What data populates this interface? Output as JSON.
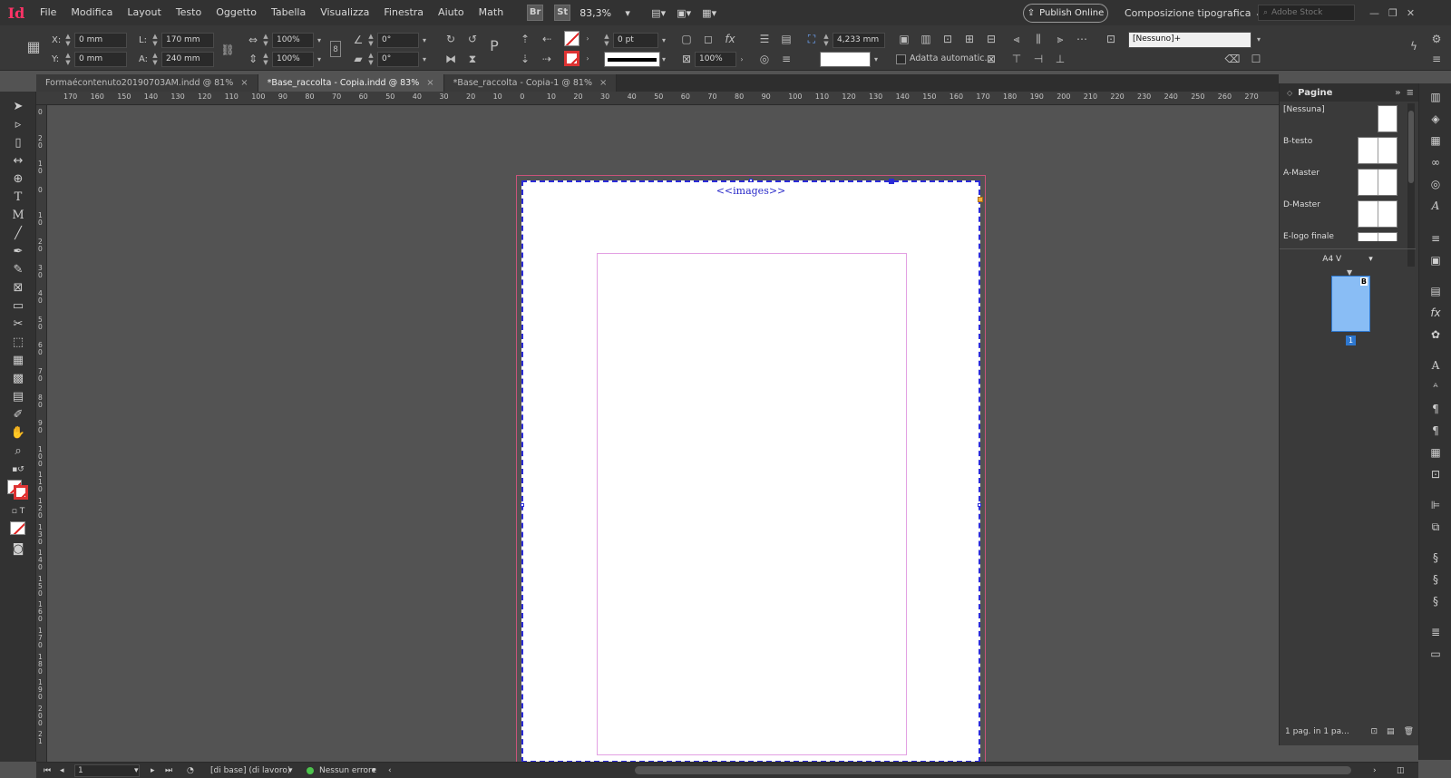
{
  "app": {
    "logo": "Id"
  },
  "menu": [
    "File",
    "Modifica",
    "Layout",
    "Testo",
    "Oggetto",
    "Tabella",
    "Visualizza",
    "Finestra",
    "Aiuto",
    "Math"
  ],
  "menubar": {
    "bridge_badge": "Br",
    "stock_badge": "St",
    "zoom": "83,3%",
    "publish_label": "Publish Online",
    "workspace": "Composizione tipografica",
    "stock_placeholder": "Adobe Stock"
  },
  "control": {
    "x_label": "X:",
    "x_value": "0 mm",
    "y_label": "Y:",
    "y_value": "0 mm",
    "w_label": "L:",
    "w_value": "170 mm",
    "h_label": "A:",
    "h_value": "240 mm",
    "scale_x": "100%",
    "scale_y": "100%",
    "rotation": "0°",
    "shear": "0°",
    "stroke_weight": "0 pt",
    "opacity": "100%",
    "offset_value": "4,233 mm",
    "autofit_label": "Adatta automatic...",
    "style_value": "[Nessuno]+"
  },
  "tabs": [
    {
      "label": "Formaécontenuto20190703AM.indd @ 81%",
      "active": false
    },
    {
      "label": "*Base_raccolta - Copia.indd @ 83%",
      "active": true
    },
    {
      "label": "*Base_raccolta - Copia-1 @ 81%",
      "active": false
    }
  ],
  "ruler_h": [
    "170",
    "160",
    "150",
    "140",
    "130",
    "120",
    "110",
    "100",
    "90",
    "80",
    "70",
    "60",
    "50",
    "40",
    "30",
    "20",
    "10",
    "0",
    "10",
    "20",
    "30",
    "40",
    "50",
    "60",
    "70",
    "80",
    "90",
    "100",
    "110",
    "120",
    "130",
    "140",
    "150",
    "160",
    "170",
    "180",
    "190",
    "200",
    "210",
    "220",
    "230",
    "240",
    "250",
    "260",
    "270"
  ],
  "ruler_v": [
    "0",
    "2\n0",
    "1\n0",
    "0",
    "1\n0",
    "2\n0",
    "3\n0",
    "4\n0",
    "5\n0",
    "6\n0",
    "7\n0",
    "8\n0",
    "9\n0",
    "1\n0\n0",
    "1\n1\n0",
    "1\n2\n0",
    "1\n3\n0",
    "1\n4\n0",
    "1\n5\n0",
    "1\n6\n0",
    "1\n7\n0",
    "1\n8\n0",
    "1\n9\n0",
    "2\n0\n0",
    "2\n1"
  ],
  "document": {
    "placeholder": "<<images>>"
  },
  "pages_panel": {
    "title": "Pagine",
    "masters": [
      {
        "name": "[Nessuna]",
        "double": false
      },
      {
        "name": "B-testo",
        "double": true
      },
      {
        "name": "A-Master",
        "double": true
      },
      {
        "name": "D-Master",
        "double": true
      },
      {
        "name": "E-logo finale",
        "double": true
      }
    ],
    "page_size": "A4 V",
    "page_master_letter": "B",
    "page_number": "1",
    "footer": "1 pag. in 1 pa..."
  },
  "status": {
    "page": "1",
    "preflight_profile": "[di base] (di lavoro)",
    "errors": "Nessun errore"
  }
}
